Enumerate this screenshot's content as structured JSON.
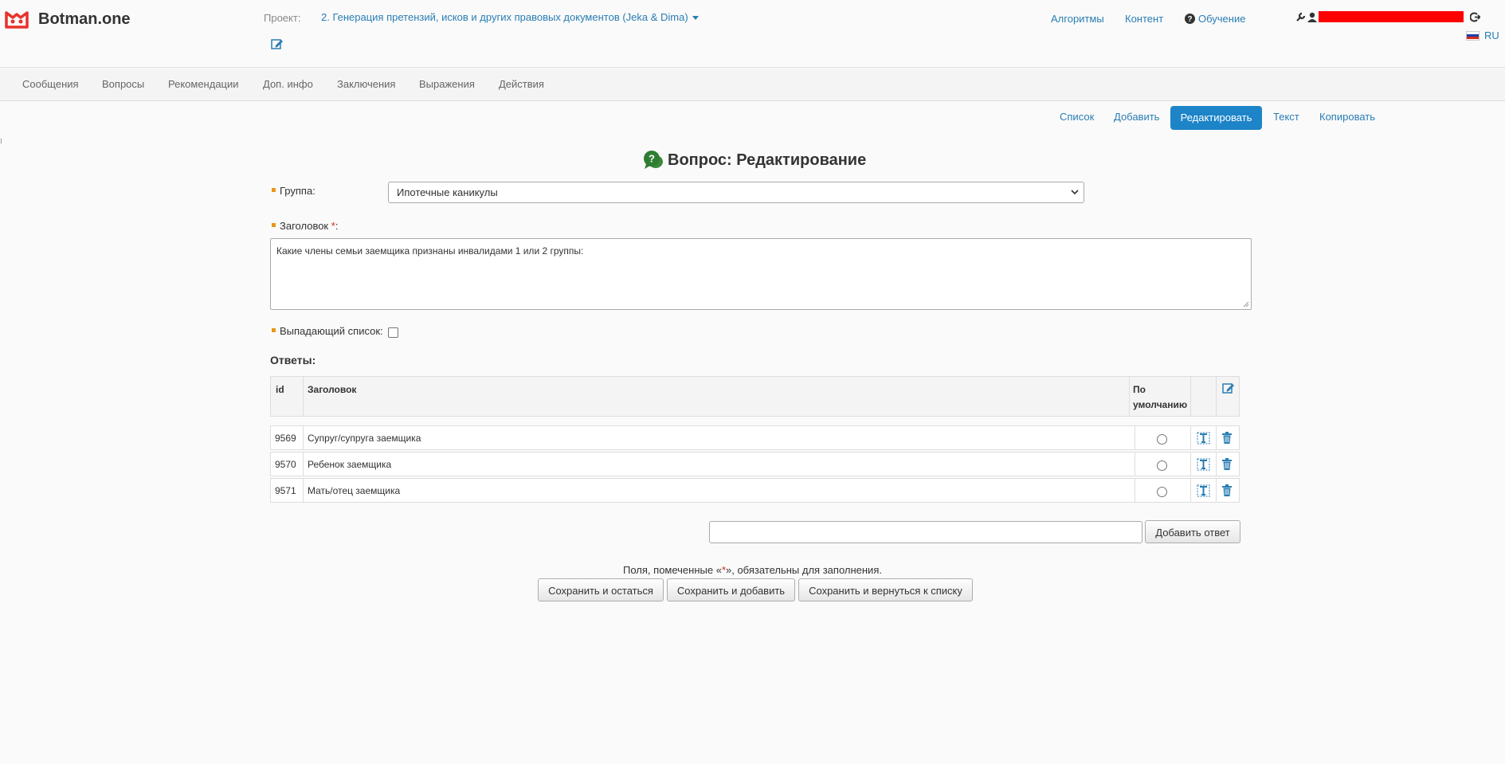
{
  "header": {
    "app_name": "Botman.one",
    "project_label": "Проект:",
    "project_name": "2. Генерация претензий, исков и других правовых документов (Jeka & Dima)",
    "nav": [
      "Алгоритмы",
      "Контент",
      "Обучение"
    ],
    "lang": "RU"
  },
  "subnav": {
    "items": [
      "Сообщения",
      "Вопросы",
      "Рекомендации",
      "Доп. инфо",
      "Заключения",
      "Выражения",
      "Действия"
    ]
  },
  "actions": {
    "items": [
      "Список",
      "Добавить",
      "Редактировать",
      "Текст",
      "Копировать"
    ],
    "active": "Редактировать"
  },
  "form": {
    "title": "Вопрос: Редактирование",
    "group_label": "Группа:",
    "group_value": "Ипотечные каникулы",
    "heading_label": "Заголовок",
    "heading_required": "*",
    "heading_suffix": ":",
    "heading_value": "Какие члены семьи заемщика признаны инвалидами 1 или 2 группы:",
    "dropdown_label": "Выпадающий список:",
    "answers_title": "Ответы:"
  },
  "table": {
    "col_id": "id",
    "col_title": "Заголовок",
    "col_default_1": "По",
    "col_default_2": "умолчанию",
    "rows": [
      {
        "id": "9569",
        "title": "Супруг/супруга заемщика"
      },
      {
        "id": "9570",
        "title": "Ребенок заемщика"
      },
      {
        "id": "9571",
        "title": "Мать/отец заемщика"
      }
    ]
  },
  "add_answer_button": "Добавить ответ",
  "footer": {
    "note_before": "Поля, помеченные «",
    "note_mark": "*",
    "note_after": "», обязательны для заполнения.",
    "buttons": [
      "Сохранить и остаться",
      "Сохранить и добавить",
      "Сохранить и вернуться к списку"
    ]
  },
  "colors": {
    "accent": "#1d84c8",
    "link": "#2a7db4",
    "logo": "#e8312b",
    "bullet": "#e8961b",
    "required": "#d9231b"
  }
}
